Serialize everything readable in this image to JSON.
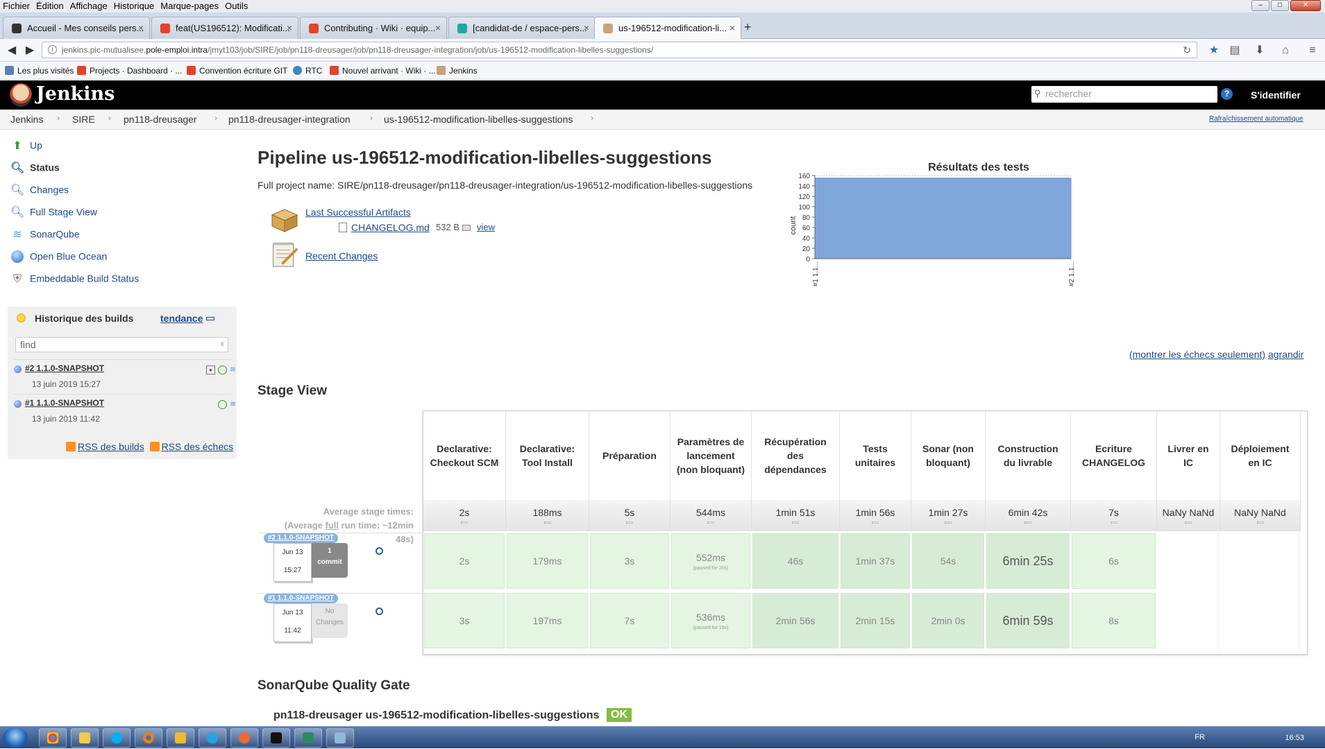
{
  "browser": {
    "menu": [
      "Fichier",
      "Édition",
      "Affichage",
      "Historique",
      "Marque-pages",
      "Outils"
    ],
    "tabs": [
      {
        "label": "Accueil - Mes conseils pers...",
        "color": "#333333"
      },
      {
        "label": "feat(US196512): Modificati...",
        "color": "#e24329"
      },
      {
        "label": "Contributing · Wiki · equip...",
        "color": "#e24329"
      },
      {
        "label": "[candidat-de / espace-pers...",
        "color": "#22a7a0"
      },
      {
        "label": "us-196512-modification-li...",
        "color": "#c8a27a"
      }
    ],
    "url_pre": "jenkins.pic-mutualisee.",
    "url_host": "pole-emploi.intra",
    "url_post": "/jmyt103/job/SIRE/job/pn118-dreusager/job/pn118-dreusager-integration/job/us-196512-modification-libelles-suggestions/",
    "bookmarks": [
      {
        "label": "Les plus visités",
        "color": "#5b7fb5"
      },
      {
        "label": "Projects · Dashboard · ...",
        "color": "#e24329"
      },
      {
        "label": "Convention écriture GIT",
        "color": "#e24329"
      },
      {
        "label": "RTC",
        "color": "#3a86c8"
      },
      {
        "label": "Nouvel arrivant · Wiki · ...",
        "color": "#e24329"
      },
      {
        "label": "Jenkins",
        "color": "#c8a27a"
      }
    ]
  },
  "jenkins": {
    "title": "Jenkins",
    "search_placeholder": "rechercher",
    "help": "?",
    "login": "S'identifier",
    "breadcrumbs": [
      "Jenkins",
      "SIRE",
      "pn118-dreusager",
      "pn118-dreusager-integration",
      "us-196512-modification-libelles-suggestions"
    ],
    "autorefresh": "Rafraîchissement automatique"
  },
  "side": {
    "tasks": [
      {
        "label": "Up",
        "icon": "up-arrow-icon"
      },
      {
        "label": "Status",
        "icon": "magnifier-icon"
      },
      {
        "label": "Changes",
        "icon": "magnifier-icon"
      },
      {
        "label": "Full Stage View",
        "icon": "magnifier-icon"
      },
      {
        "label": "SonarQube",
        "icon": "sonarqube-icon"
      },
      {
        "label": "Open Blue Ocean",
        "icon": "blue-ocean-icon"
      },
      {
        "label": "Embeddable Build Status",
        "icon": "shield-icon"
      }
    ],
    "history": {
      "title": "Historique des builds",
      "trend": "tendance",
      "find_placeholder": "find",
      "clear": "x",
      "builds": [
        {
          "name": "#2 1.1.0-SNAPSHOT",
          "date": "13 juin 2019 15:27"
        },
        {
          "name": "#1 1.1.0-SNAPSHOT",
          "date": "13 juin 2019 11:42"
        }
      ],
      "rss_builds": "RSS des builds",
      "rss_fails": "RSS des échecs"
    }
  },
  "main": {
    "title": "Pipeline us-196512-modification-libelles-suggestions",
    "full_name": "Full project name: SIRE/pn118-dreusager/pn118-dreusager-integration/us-196512-modification-libelles-suggestions",
    "last_artifacts": "Last Successful Artifacts",
    "artifact_file": "CHANGELOG.md",
    "artifact_size": "532 B",
    "artifact_view": "view",
    "recent_changes": "Recent Changes",
    "chart_links": {
      "fails_only": "(montrer les échecs seulement)",
      "enlarge": "agrandir"
    },
    "stage_view_title": "Stage View",
    "avg_line1": "Average stage times:",
    "avg_line2a": "(Average ",
    "avg_full": "full",
    "avg_line2b": " run time: ~12min",
    "avg_line3": "48s)",
    "stages": [
      {
        "name": "Declarative: Checkout SCM",
        "avg": "2s"
      },
      {
        "name": "Declarative: Tool Install",
        "avg": "188ms"
      },
      {
        "name": "Préparation",
        "avg": "5s"
      },
      {
        "name": "Paramètres de lancement (non bloquant)",
        "avg": "544ms"
      },
      {
        "name": "Récupération des dépendances",
        "avg": "1min 51s"
      },
      {
        "name": "Tests unitaires",
        "avg": "1min 56s"
      },
      {
        "name": "Sonar (non bloquant)",
        "avg": "1min 27s"
      },
      {
        "name": "Construction du livrable",
        "avg": "6min 42s"
      },
      {
        "name": "Ecriture CHANGELOG",
        "avg": "7s"
      },
      {
        "name": "Livrer en IC",
        "avg": "NaNy NaNd"
      },
      {
        "name": "Déploiement en IC",
        "avg": "NaNy NaNd"
      }
    ],
    "runs": [
      {
        "tag": "#2 1.1.0-SNAPSHOT",
        "date": "Jun 13",
        "time": "15:27",
        "commit_count": "1",
        "commit_label": "commit",
        "cells": [
          "2s",
          "179ms",
          "3s",
          "552ms",
          "46s",
          "1min 37s",
          "54s",
          "6min 25s",
          "6s",
          "",
          ""
        ],
        "pause_note": "(paused for 20s)"
      },
      {
        "tag": "#1 1.1.0-SNAPSHOT",
        "date": "Jun 13",
        "time": "11:42",
        "commit_count": "No",
        "commit_label": "Changes",
        "cells": [
          "3s",
          "197ms",
          "7s",
          "536ms",
          "2min 56s",
          "2min 15s",
          "2min 0s",
          "6min 59s",
          "8s",
          "",
          ""
        ],
        "pause_note": "(paused for 19s)"
      }
    ],
    "sonar_title": "SonarQube Quality Gate",
    "sonar_project": "pn118-dreusager us-196512-modification-libelles-suggestions",
    "sonar_status": "OK"
  },
  "chart_data": {
    "type": "area",
    "title": "Résultats des tests",
    "ylabel": "count",
    "xlabel": "",
    "x": [
      "#1 1.1...",
      "#2 1.1..."
    ],
    "series": [
      {
        "values": [
          155,
          155
        ]
      }
    ],
    "ylim": [
      0,
      160
    ],
    "yticks": [
      0,
      20,
      40,
      60,
      80,
      100,
      120,
      140,
      160
    ],
    "color": "#7fa6d9",
    "grid": true
  },
  "taskbar": {
    "lang": "FR",
    "clock": "16:53"
  }
}
